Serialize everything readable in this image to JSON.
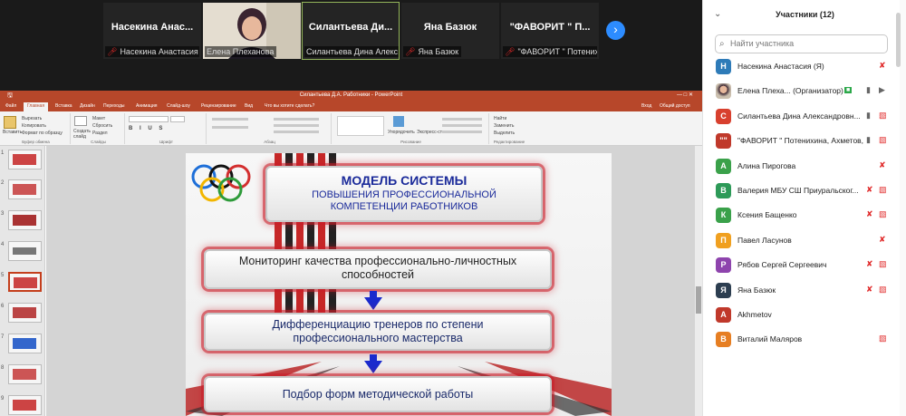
{
  "video_strip": {
    "tiles": [
      {
        "name": "Насекина  Анас...",
        "label": "Насекина Анастасия"
      },
      {
        "name": "",
        "label": "Елена Плеханова"
      },
      {
        "name": "Силантьева  Ди...",
        "label": "Силантьева Дина Алекс..."
      },
      {
        "name": "Яна Базюк",
        "label": "Яна Базюк"
      },
      {
        "name": "\"ФАВОРИТ \" П...",
        "label": "\"ФАВОРИТ \" Потенихи..."
      }
    ],
    "next_icon": "chevron-right-icon"
  },
  "powerpoint": {
    "window_title": "Силантьева Д.А. Работники - PowerPoint",
    "tabs": [
      "Файл",
      "Главная",
      "Вставка",
      "Дизайн",
      "Переходы",
      "Анимация",
      "Слайд-шоу",
      "Рецензирование",
      "Вид",
      "Что вы хотите сделать?"
    ],
    "ribbon_groups": [
      "Буфер обмена",
      "Слайды",
      "Шрифт",
      "Абзац",
      "Рисование",
      "Редактирование"
    ],
    "ribbon_items": {
      "paste": "Вставить",
      "cut": "Вырезать",
      "copy": "Копировать",
      "format": "Формат по образцу",
      "create": "Создать слайд",
      "layout": "Макет",
      "reset": "Сбросить",
      "section": "Раздел",
      "arrange": "Упорядочить",
      "styles": "Экспресс-стили",
      "find": "Найти",
      "replace": "Заменить",
      "select": "Выделить"
    },
    "account": "Вход",
    "share": "Общий доступ",
    "slide_numbers": [
      "1",
      "2",
      "3",
      "4",
      "5",
      "6",
      "7",
      "8",
      "9"
    ],
    "selected_slide": 5
  },
  "slide": {
    "title": "МОДЕЛЬ СИСТЕМЫ",
    "subtitle_line1": "ПОВЫШЕНИЯ ПРОФЕССИОНАЛЬНОЙ",
    "subtitle_line2": "КОМПЕТЕНЦИИ РАБОТНИКОВ",
    "box1_line1": "Мониторинг качества профессионально-личностных",
    "box1_line2": "способностей",
    "box2_line1": "Дифференциацию тренеров по степени",
    "box2_line2": "профессионального мастерства",
    "box3_line1": "Подбор форм методической работы"
  },
  "participants": {
    "title": "Участники (12)",
    "search_placeholder": "Найти участника",
    "list": [
      {
        "initial": "Н",
        "name": "Насекина Анастасия (Я)",
        "color": "#2e7bb8",
        "mic": "muted",
        "cam": ""
      },
      {
        "initial": "",
        "name": "Елена Плеха...  (Организатор)",
        "color": "#a08070",
        "mic": "on",
        "cam": "on",
        "photo": true
      },
      {
        "initial": "С",
        "name": "Силантьева Дина Александровн...",
        "color": "#d8402e",
        "mic": "on",
        "cam": "off"
      },
      {
        "initial": "\"\"",
        "name": "\"ФАВОРИТ \" Потенихина, Ахметов, Р...",
        "color": "#c0392b",
        "mic": "on",
        "cam": "off"
      },
      {
        "initial": "А",
        "name": "Алина Пирогова",
        "color": "#3aa14a",
        "mic": "muted",
        "cam": ""
      },
      {
        "initial": "В",
        "name": "Валерия МБУ СШ Приуральског...",
        "color": "#2d9a58",
        "mic": "muted",
        "cam": "off"
      },
      {
        "initial": "К",
        "name": "Ксения Бащенко",
        "color": "#3aa14a",
        "mic": "muted",
        "cam": "off"
      },
      {
        "initial": "П",
        "name": "Павел Ласунов",
        "color": "#f0a020",
        "mic": "muted",
        "cam": ""
      },
      {
        "initial": "Р",
        "name": "Рябов Сергей Сергеевич",
        "color": "#8e44ad",
        "mic": "muted",
        "cam": "off"
      },
      {
        "initial": "Я",
        "name": "Яна Базюк",
        "color": "#2c3e50",
        "mic": "muted",
        "cam": "off"
      },
      {
        "initial": "А",
        "name": "Akhmetov",
        "color": "#c0392b",
        "mic": "",
        "cam": ""
      },
      {
        "initial": "В",
        "name": "Виталий Маляров",
        "color": "#e67e22",
        "mic": "",
        "cam": "off"
      }
    ]
  }
}
